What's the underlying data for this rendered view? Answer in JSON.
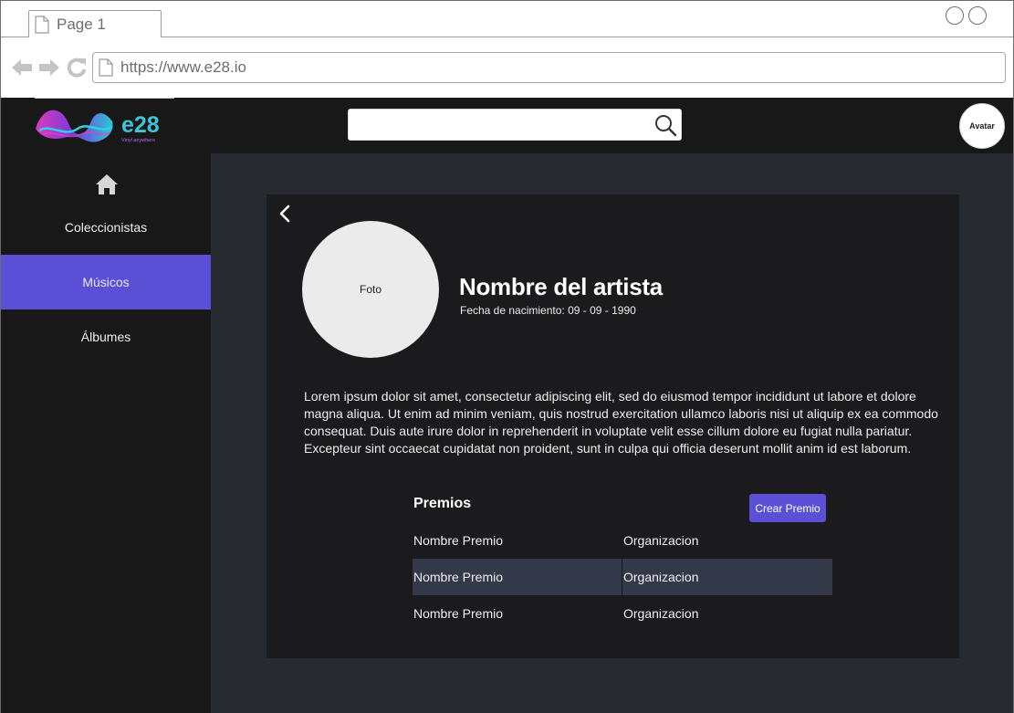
{
  "browser": {
    "tab_label": "Page 1",
    "url": "https://www.e28.io"
  },
  "app": {
    "logo_text": "e28",
    "logo_tagline": "Vinyl anywhere",
    "search": {
      "placeholder": ""
    },
    "avatar_label": "Avatar",
    "colors": {
      "accent": "#5b4fd6",
      "background": "#181819",
      "content_bg": "#272a31"
    }
  },
  "sidebar": {
    "home_icon": "home-icon",
    "items": [
      {
        "label": "Coleccionistas",
        "active": false
      },
      {
        "label": "Músicos",
        "active": true
      },
      {
        "label": "Álbumes",
        "active": false
      }
    ]
  },
  "artist": {
    "photo_label": "Foto",
    "name": "Nombre del artista",
    "birth": "Fecha de nacimiento: 09 - 09 - 1990",
    "bio": "Lorem ipsum dolor sit amet, consectetur adipiscing elit, sed do eiusmod tempor incididunt ut labore et dolore magna aliqua. Ut enim ad minim veniam, quis nostrud exercitation ullamco laboris nisi ut aliquip ex ea commodo consequat. Duis aute irure dolor in reprehenderit in voluptate velit esse cillum dolore eu fugiat nulla pariatur. Excepteur sint occaecat cupidatat non proident, sunt in culpa qui officia deserunt mollit anim id est laborum."
  },
  "awards": {
    "title": "Premios",
    "create_label": "Crear Premio",
    "rows": [
      {
        "name": "Nombre Premio",
        "org": "Organizacion"
      },
      {
        "name": "Nombre Premio",
        "org": "Organizacion"
      },
      {
        "name": "Nombre Premio",
        "org": "Organizacion"
      }
    ]
  }
}
